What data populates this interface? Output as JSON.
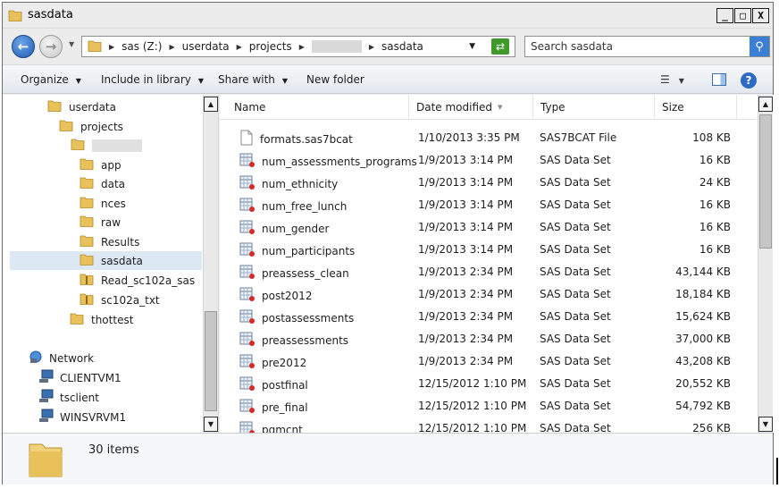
{
  "window": {
    "title": "sasdata"
  },
  "window_buttons": {
    "minimize": "_",
    "maximize": "□",
    "close": "X"
  },
  "address": {
    "crumbs": [
      "sas (Z:)",
      "userdata",
      "projects",
      "sasdata"
    ],
    "search_placeholder": "Search sasdata"
  },
  "toolbar": {
    "organize": "Organize",
    "include_in_library": "Include in library",
    "share_with": "Share with",
    "new_folder": "New folder"
  },
  "nav_tree": [
    {
      "label": "userdata",
      "icon": "folder-icon",
      "indent": 0
    },
    {
      "label": "projects",
      "icon": "folder-icon",
      "indent": 1
    },
    {
      "label": "",
      "icon": "folder-icon",
      "indent": 2,
      "redacted": true
    },
    {
      "label": "app",
      "icon": "folder-icon",
      "indent": 3
    },
    {
      "label": "data",
      "icon": "folder-icon",
      "indent": 3
    },
    {
      "label": "nces",
      "icon": "folder-icon",
      "indent": 3
    },
    {
      "label": "raw",
      "icon": "folder-icon",
      "indent": 3
    },
    {
      "label": "Results",
      "icon": "folder-icon",
      "indent": 3
    },
    {
      "label": "sasdata",
      "icon": "folder-icon",
      "indent": 3,
      "selected": true
    },
    {
      "label": "Read_sc102a_sas",
      "icon": "zip-folder-icon",
      "indent": 3
    },
    {
      "label": "sc102a_txt",
      "icon": "zip-folder-icon",
      "indent": 3
    },
    {
      "label": "thottest",
      "icon": "folder-icon",
      "indent": 2
    },
    {
      "label": "Network",
      "icon": "network-icon",
      "indent": -1
    },
    {
      "label": "CLIENTVM1",
      "icon": "computer-icon",
      "indent": 0
    },
    {
      "label": "tsclient",
      "icon": "computer-icon",
      "indent": 0
    },
    {
      "label": "WINSVRVM1",
      "icon": "computer-icon",
      "indent": 0
    }
  ],
  "columns": {
    "name": "Name",
    "date": "Date modified",
    "type": "Type",
    "size": "Size"
  },
  "files": [
    {
      "name": "formats.sas7bcat",
      "date": "1/10/2013 3:35 PM",
      "type": "SAS7BCAT File",
      "size": "108 KB",
      "icon": "generic-file-icon"
    },
    {
      "name": "num_assessments_programs",
      "date": "1/9/2013 3:14 PM",
      "type": "SAS Data Set",
      "size": "16 KB",
      "icon": "sas-dataset-icon"
    },
    {
      "name": "num_ethnicity",
      "date": "1/9/2013 3:14 PM",
      "type": "SAS Data Set",
      "size": "24 KB",
      "icon": "sas-dataset-icon"
    },
    {
      "name": "num_free_lunch",
      "date": "1/9/2013 3:14 PM",
      "type": "SAS Data Set",
      "size": "16 KB",
      "icon": "sas-dataset-icon"
    },
    {
      "name": "num_gender",
      "date": "1/9/2013 3:14 PM",
      "type": "SAS Data Set",
      "size": "16 KB",
      "icon": "sas-dataset-icon"
    },
    {
      "name": "num_participants",
      "date": "1/9/2013 3:14 PM",
      "type": "SAS Data Set",
      "size": "16 KB",
      "icon": "sas-dataset-icon"
    },
    {
      "name": "preassess_clean",
      "date": "1/9/2013 2:34 PM",
      "type": "SAS Data Set",
      "size": "43,144 KB",
      "icon": "sas-dataset-icon"
    },
    {
      "name": "post2012",
      "date": "1/9/2013 2:34 PM",
      "type": "SAS Data Set",
      "size": "18,184 KB",
      "icon": "sas-dataset-icon"
    },
    {
      "name": "postassessments",
      "date": "1/9/2013 2:34 PM",
      "type": "SAS Data Set",
      "size": "15,624 KB",
      "icon": "sas-dataset-icon"
    },
    {
      "name": "preassessments",
      "date": "1/9/2013 2:34 PM",
      "type": "SAS Data Set",
      "size": "37,000 KB",
      "icon": "sas-dataset-icon"
    },
    {
      "name": "pre2012",
      "date": "1/9/2013 2:34 PM",
      "type": "SAS Data Set",
      "size": "43,208 KB",
      "icon": "sas-dataset-icon"
    },
    {
      "name": "postfinal",
      "date": "12/15/2012 1:10 PM",
      "type": "SAS Data Set",
      "size": "20,552 KB",
      "icon": "sas-dataset-icon"
    },
    {
      "name": "pre_final",
      "date": "12/15/2012 1:10 PM",
      "type": "SAS Data Set",
      "size": "54,792 KB",
      "icon": "sas-dataset-icon"
    },
    {
      "name": "pgmcnt",
      "date": "12/15/2012 1:10 PM",
      "type": "SAS Data Set",
      "size": "256 KB",
      "icon": "sas-dataset-icon"
    }
  ],
  "status": {
    "item_count": "30 items"
  },
  "colors": {
    "folder": "#e8c15a",
    "selection": "#dde8f5",
    "accent": "#1e5cb3"
  }
}
